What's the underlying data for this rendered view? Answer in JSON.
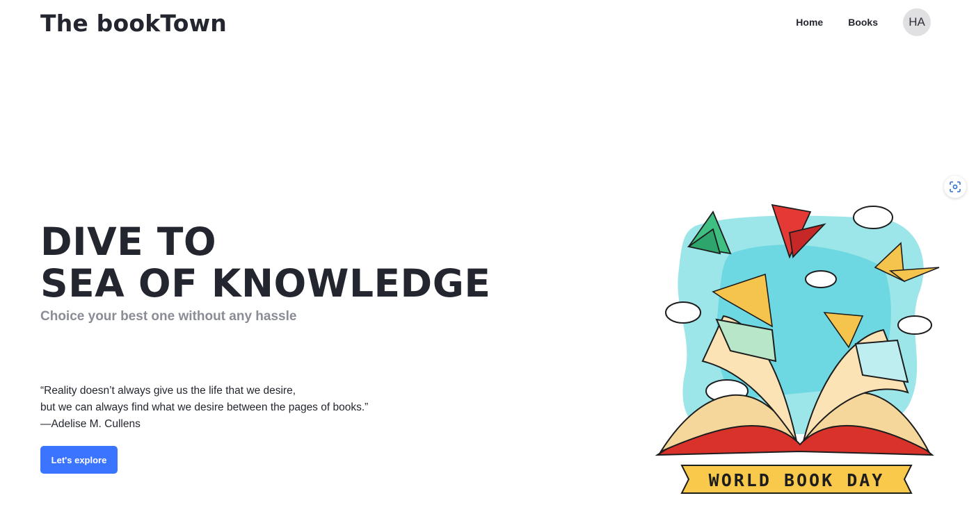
{
  "header": {
    "brand": "The bookTown",
    "nav": [
      {
        "label": "Home"
      },
      {
        "label": "Books"
      }
    ],
    "avatar_initials": "HA"
  },
  "hero": {
    "title_line1": "DIVE TO",
    "title_line2": "SEA OF KNOWLEDGE",
    "subtitle": "Choice your best one without any hassle",
    "quote_line1": "“Reality doesn’t always give us the life that we desire,",
    "quote_line2": "but we can always find what we desire between the pages of books.”",
    "quote_author": "—Adelise M. Cullens",
    "cta_label": "Let's explore"
  },
  "illustration": {
    "banner_text": "WORLD BOOK DAY"
  },
  "colors": {
    "accent": "#3b74ff",
    "text": "#23262f",
    "muted": "#8a8d96"
  },
  "icons": [
    "scan-icon"
  ]
}
